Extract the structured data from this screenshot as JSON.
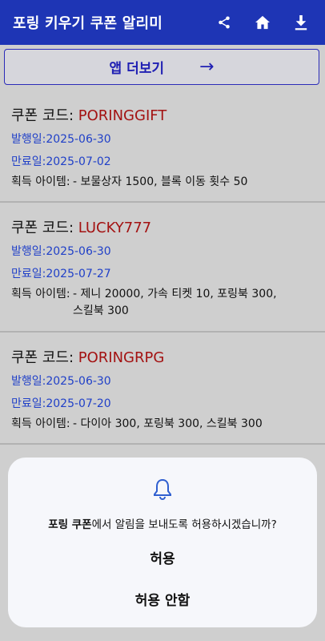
{
  "appbar": {
    "title": "포링 키우기 쿠폰 알리미",
    "icons": [
      "share-icon",
      "home-icon",
      "download-icon"
    ]
  },
  "more_apps": {
    "label": "앱 더보기",
    "arrow": "→"
  },
  "coupons": [
    {
      "code_label": "쿠폰 코드: ",
      "code": "PORINGGIFT",
      "issued": "발행일:2025-06-30",
      "expires": "만료일:2025-07-02",
      "items_label": "획득 아이템:",
      "items": "- 보물상자 1500, 블록 이동 횟수 50"
    },
    {
      "code_label": "쿠폰 코드: ",
      "code": "LUCKY777",
      "issued": "발행일:2025-06-30",
      "expires": "만료일:2025-07-27",
      "items_label": "획득 아이템:",
      "items": "- 제니 20000, 가속 티켓 10, 포링북 300, 스킬북 300"
    },
    {
      "code_label": "쿠폰 코드: ",
      "code": "PORINGRPG",
      "issued": "발행일:2025-06-30",
      "expires": "만료일:2025-07-20",
      "items_label": "획득 아이템:",
      "items": "- 다이아 300, 포링북 300, 스킬북 300"
    }
  ],
  "dialog": {
    "app_name": "포링 쿠폰",
    "message": "에서 알림을 보내도록 허용하시겠습니까?",
    "allow": "허용",
    "deny": "허용 안함"
  },
  "colors": {
    "appbar": "#1e35b5",
    "code": "#a31212",
    "date": "#2040c8",
    "background": "#cfcfcf"
  }
}
